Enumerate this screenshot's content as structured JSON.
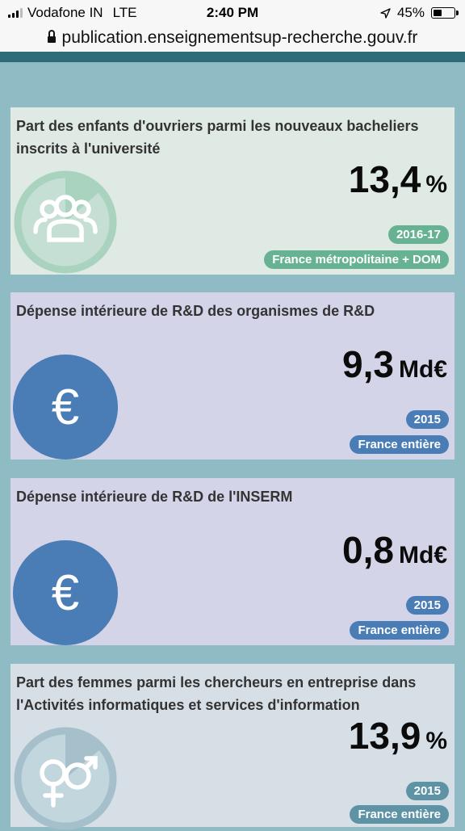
{
  "status": {
    "carrier": "Vodafone IN",
    "network": "LTE",
    "time": "2:40 PM",
    "battery": "45%",
    "battery_level": 0.45
  },
  "address": {
    "url": "publication.enseignementsup-recherche.gouv.fr"
  },
  "colors": {
    "green": "#67b293",
    "blue": "#4a7cb5",
    "teal": "#5e93a6"
  },
  "cards": [
    {
      "title": "Part des enfants d'ouvriers parmi les nouveaux bacheliers inscrits à l'université",
      "value": "13,4",
      "unit": "%",
      "year": "2016-17",
      "region": "France métropolitaine + DOM",
      "icon": "group-icon",
      "fraction": 0.134
    },
    {
      "title": "Dépense intérieure de R&D des organismes de R&D",
      "value": "9,3",
      "unit": "Md€",
      "year": "2015",
      "region": "France entière",
      "icon": "euro-icon",
      "euro_symbol": "€"
    },
    {
      "title": "Dépense intérieure de R&D de l'INSERM",
      "value": "0,8",
      "unit": "Md€",
      "year": "2015",
      "region": "France entière",
      "icon": "euro-icon",
      "euro_symbol": "€"
    },
    {
      "title": "Part des femmes parmi les chercheurs en entreprise dans l'Activités informatiques et services d'information",
      "value": "13,9",
      "unit": "%",
      "year": "2015",
      "region": "France entière",
      "icon": "gender-icon",
      "fraction": 0.139
    }
  ]
}
